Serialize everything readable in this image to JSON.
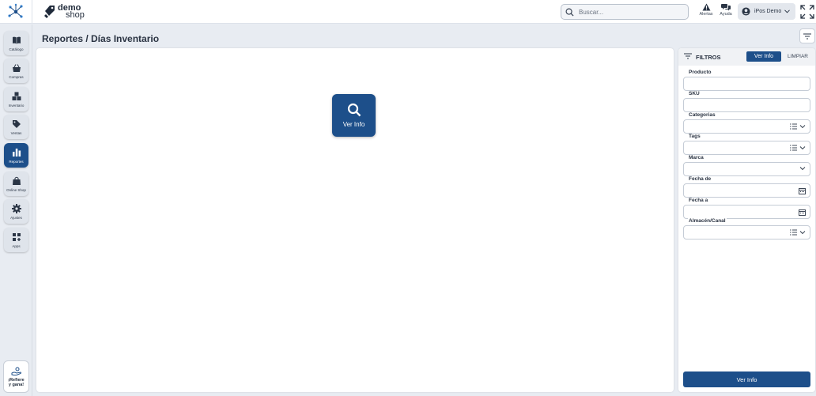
{
  "header": {
    "logo_line1": "demo",
    "logo_line2": "shop",
    "search_placeholder": "Buscar...",
    "alerts_label": "Alertas",
    "help_label": "Ayuda",
    "user_name": "iPos Demo"
  },
  "sidebar": {
    "items": [
      {
        "label": "Catálogo",
        "icon": "book-icon"
      },
      {
        "label": "Compras",
        "icon": "shopping-basket-icon"
      },
      {
        "label": "Inventario",
        "icon": "boxes-icon"
      },
      {
        "label": "Ventas",
        "icon": "tag-icon"
      },
      {
        "label": "Reportes",
        "icon": "bar-chart-icon",
        "active": true
      },
      {
        "label": "Online Shop",
        "icon": "shopping-bag-icon"
      },
      {
        "label": "Ajustes",
        "icon": "gear-icon"
      },
      {
        "label": "Apps",
        "icon": "apps-grid-icon"
      }
    ],
    "refer_line1": "¡Refiere",
    "refer_line2": "y gana!"
  },
  "page": {
    "title": "Reportes / Días Inventario"
  },
  "main": {
    "tile_label": "Ver Info"
  },
  "filters": {
    "title": "FILTROS",
    "ver_info_label": "Ver Info",
    "clear_label": "LIMPIAR",
    "fields": [
      {
        "label": "Producto",
        "value": ""
      },
      {
        "label": "SKU",
        "value": ""
      },
      {
        "label": "Categorias",
        "value": ""
      },
      {
        "label": "Tags",
        "value": ""
      },
      {
        "label": "Marca",
        "value": ""
      },
      {
        "label": "Fecha de",
        "value": ""
      },
      {
        "label": "Fecha a",
        "value": ""
      },
      {
        "label": "Almacén/Canal",
        "value": ""
      }
    ],
    "bottom_button_label": "Ver Info"
  },
  "colors": {
    "primary": "#1d4f8a",
    "background": "#e8ecf2"
  }
}
